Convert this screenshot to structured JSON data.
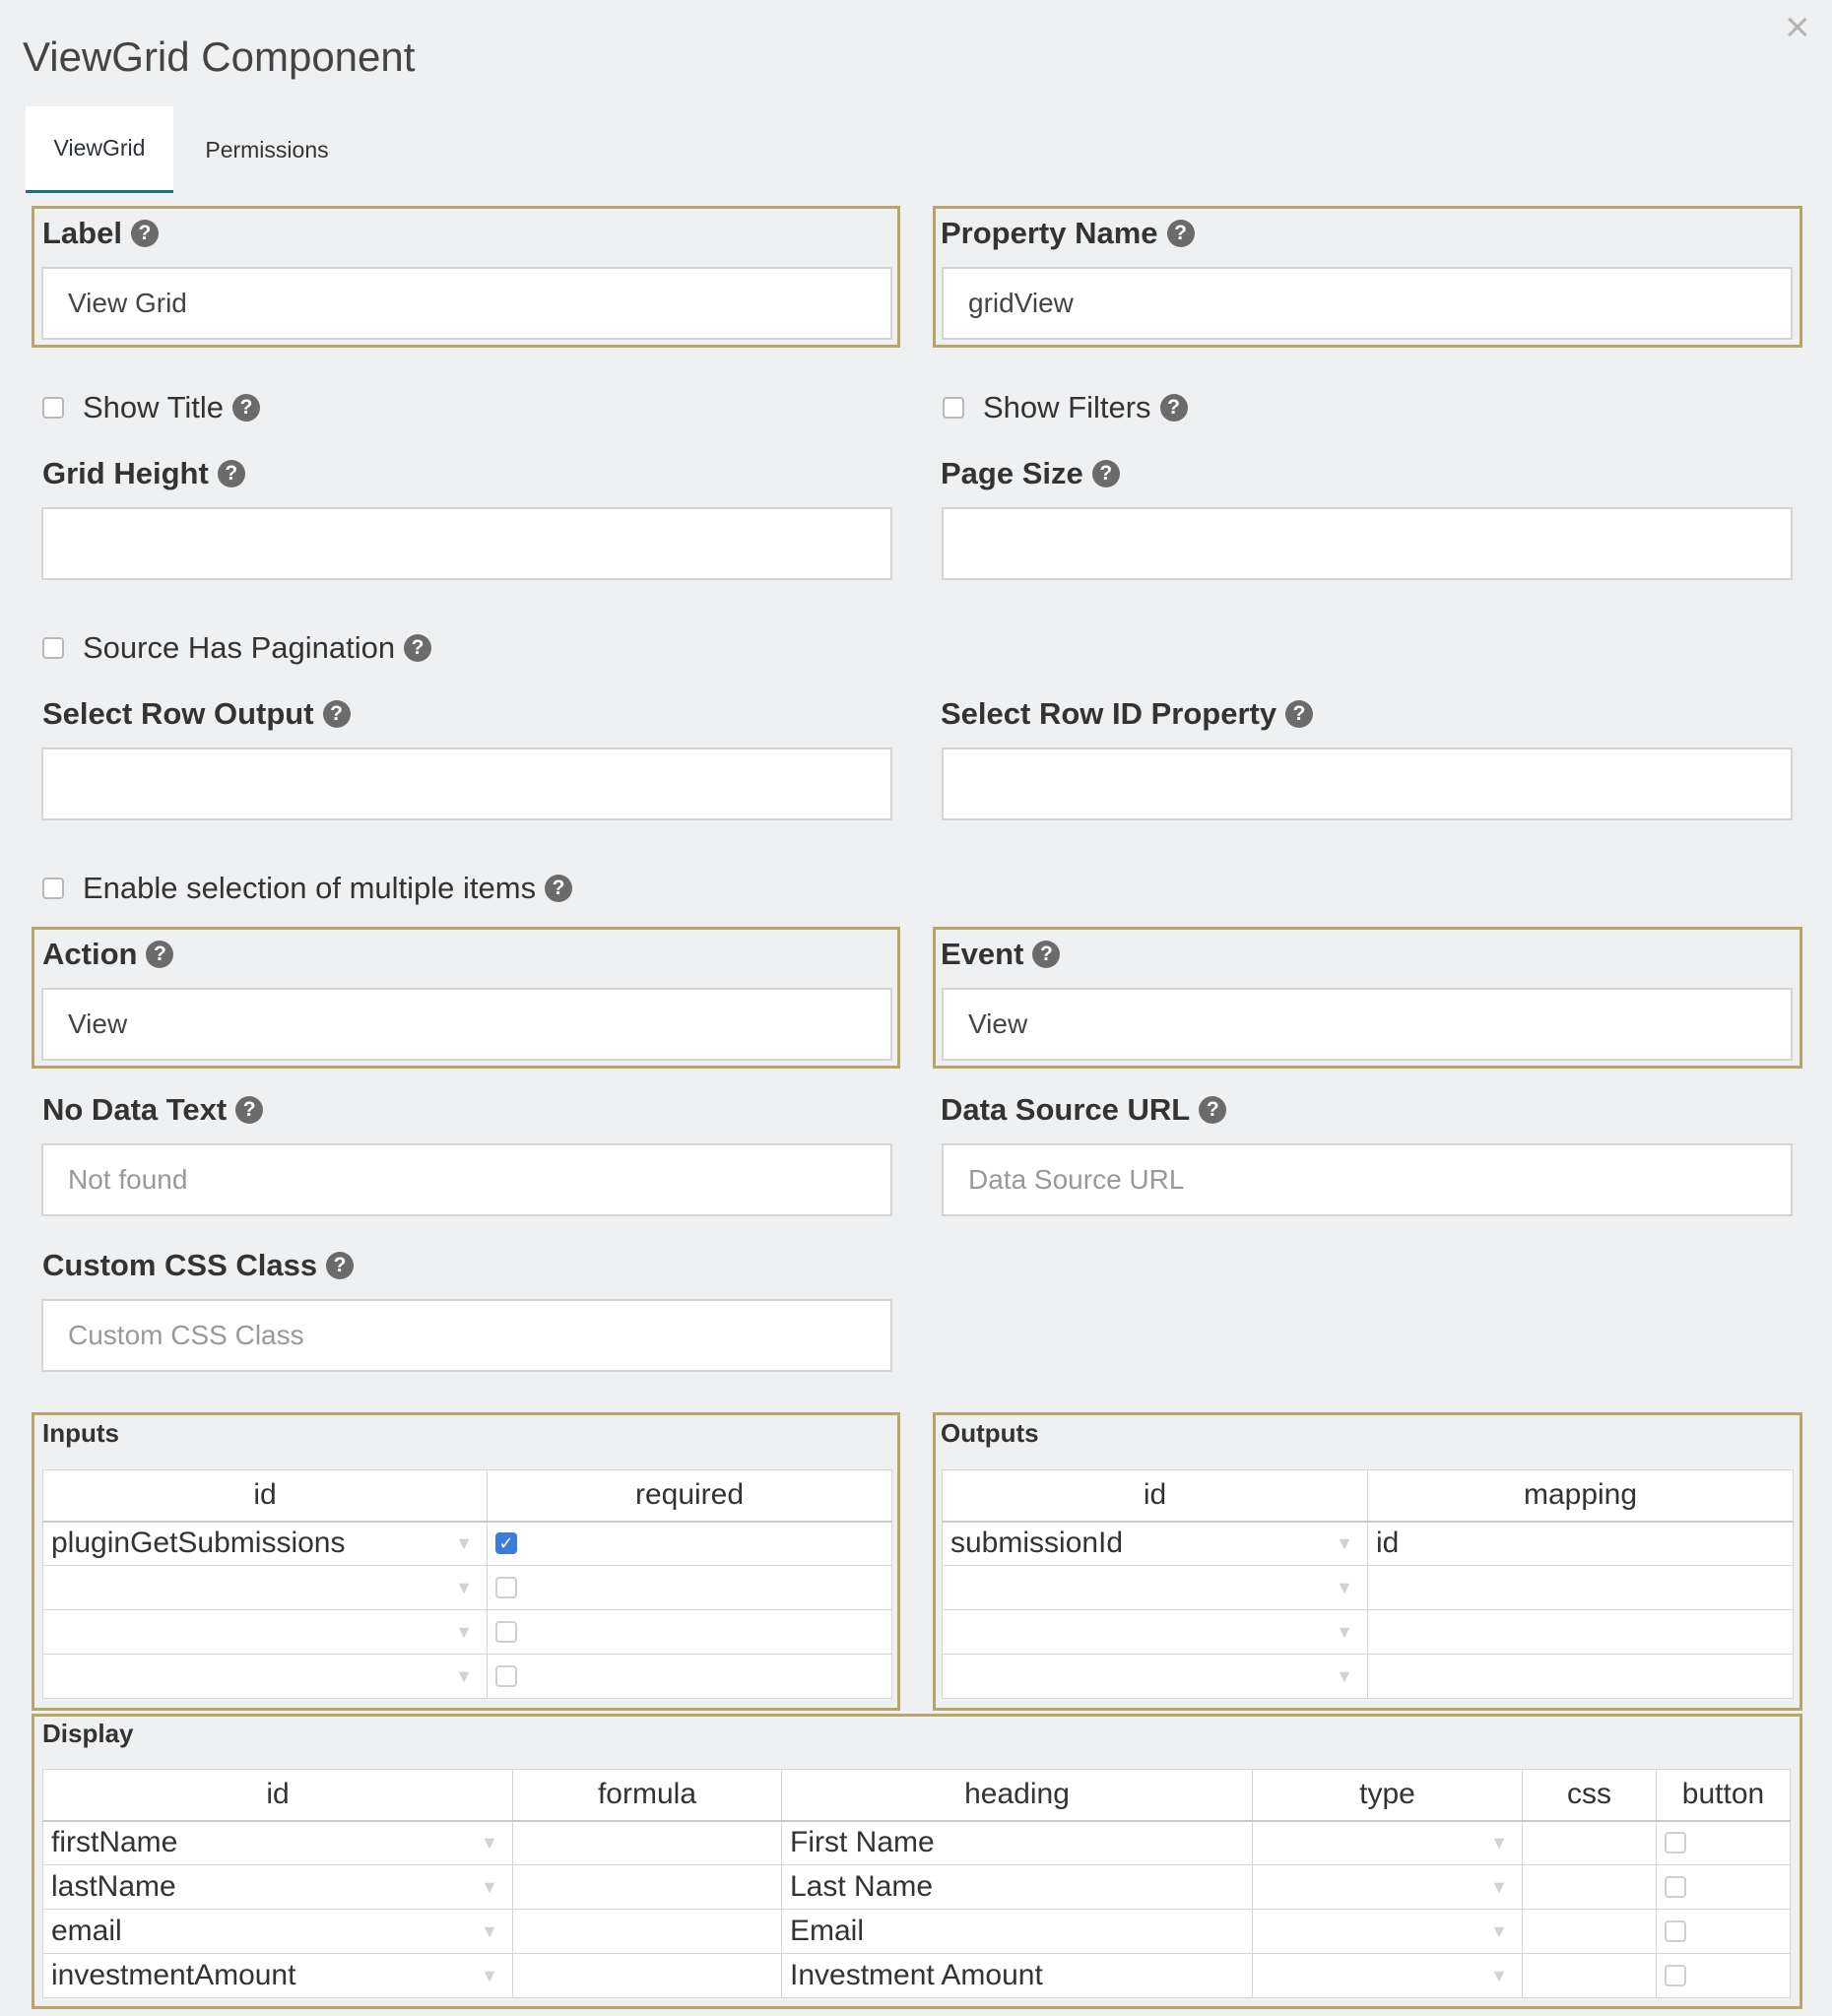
{
  "dialog": {
    "title": "ViewGrid Component",
    "close_glyph": "×"
  },
  "tabs": [
    {
      "label": "ViewGrid"
    },
    {
      "label": "Permissions"
    }
  ],
  "help_glyph": "?",
  "check_glyph": "✓",
  "arrow_glyph": "▼",
  "fields": {
    "label": {
      "label": "Label",
      "value": "View Grid"
    },
    "property_name": {
      "label": "Property Name",
      "value": "gridView"
    },
    "show_title": {
      "label": "Show Title",
      "checked": false
    },
    "show_filters": {
      "label": "Show Filters",
      "checked": false
    },
    "grid_height": {
      "label": "Grid Height",
      "value": ""
    },
    "page_size": {
      "label": "Page Size",
      "value": ""
    },
    "source_has_pagination": {
      "label": "Source Has Pagination",
      "checked": false
    },
    "select_row_output": {
      "label": "Select Row Output",
      "value": ""
    },
    "select_row_id_property": {
      "label": "Select Row ID Property",
      "value": ""
    },
    "enable_multi_select": {
      "label": "Enable selection of multiple items",
      "checked": false
    },
    "action": {
      "label": "Action",
      "value": "View"
    },
    "event": {
      "label": "Event",
      "value": "View"
    },
    "no_data_text": {
      "label": "No Data Text",
      "placeholder": "Not found"
    },
    "data_source_url": {
      "label": "Data Source URL",
      "placeholder": "Data Source URL"
    },
    "custom_css_class": {
      "label": "Custom CSS Class",
      "placeholder": "Custom CSS Class"
    }
  },
  "inputs": {
    "title": "Inputs",
    "headers": [
      "id",
      "required"
    ],
    "rows": [
      {
        "id": "pluginGetSubmissions",
        "required": true
      },
      {
        "id": "",
        "required": false
      },
      {
        "id": "",
        "required": false
      },
      {
        "id": "",
        "required": false
      }
    ]
  },
  "outputs": {
    "title": "Outputs",
    "headers": [
      "id",
      "mapping"
    ],
    "rows": [
      {
        "id": "submissionId",
        "mapping": "id"
      },
      {
        "id": "",
        "mapping": ""
      },
      {
        "id": "",
        "mapping": ""
      },
      {
        "id": "",
        "mapping": ""
      }
    ]
  },
  "display": {
    "title": "Display",
    "headers": [
      "id",
      "formula",
      "heading",
      "type",
      "css",
      "button"
    ],
    "rows": [
      {
        "id": "firstName",
        "formula": "",
        "heading": "First Name",
        "type": "",
        "css": "",
        "button": false
      },
      {
        "id": "lastName",
        "formula": "",
        "heading": "Last Name",
        "type": "",
        "css": "",
        "button": false
      },
      {
        "id": "email",
        "formula": "",
        "heading": "Email",
        "type": "",
        "css": "",
        "button": false
      },
      {
        "id": "investmentAmount",
        "formula": "",
        "heading": "Investment Amount",
        "type": "",
        "css": "",
        "button": false
      }
    ]
  }
}
